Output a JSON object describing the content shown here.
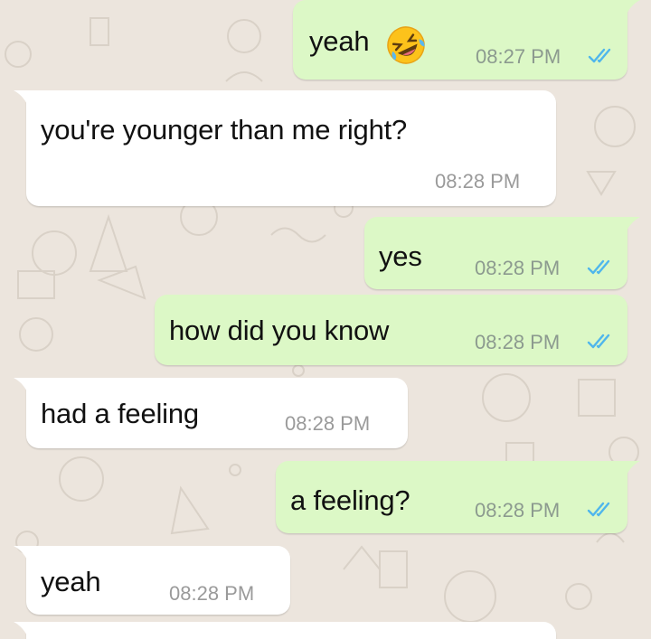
{
  "colors": {
    "outgoing_bubble": "#dcf8c6",
    "incoming_bubble": "#ffffff",
    "background": "#ece5dd",
    "read_ticks": "#4fb6ec"
  },
  "messages": [
    {
      "direction": "outgoing",
      "text": "yeah",
      "emoji": "rolling-on-the-floor-laughing-emoji",
      "time": "08:27 PM",
      "status": "read"
    },
    {
      "direction": "incoming",
      "text": "you're younger than me right?",
      "time": "08:28 PM"
    },
    {
      "direction": "outgoing",
      "text": "yes",
      "time": "08:28 PM",
      "status": "read"
    },
    {
      "direction": "outgoing",
      "text": "how did you know",
      "time": "08:28 PM",
      "status": "read"
    },
    {
      "direction": "incoming",
      "text": "had a feeling",
      "time": "08:28 PM"
    },
    {
      "direction": "outgoing",
      "text": "a feeling?",
      "time": "08:28 PM",
      "status": "read"
    },
    {
      "direction": "incoming",
      "text": "yeah",
      "time": "08:28 PM"
    },
    {
      "direction": "incoming",
      "text": "",
      "time": ""
    }
  ]
}
